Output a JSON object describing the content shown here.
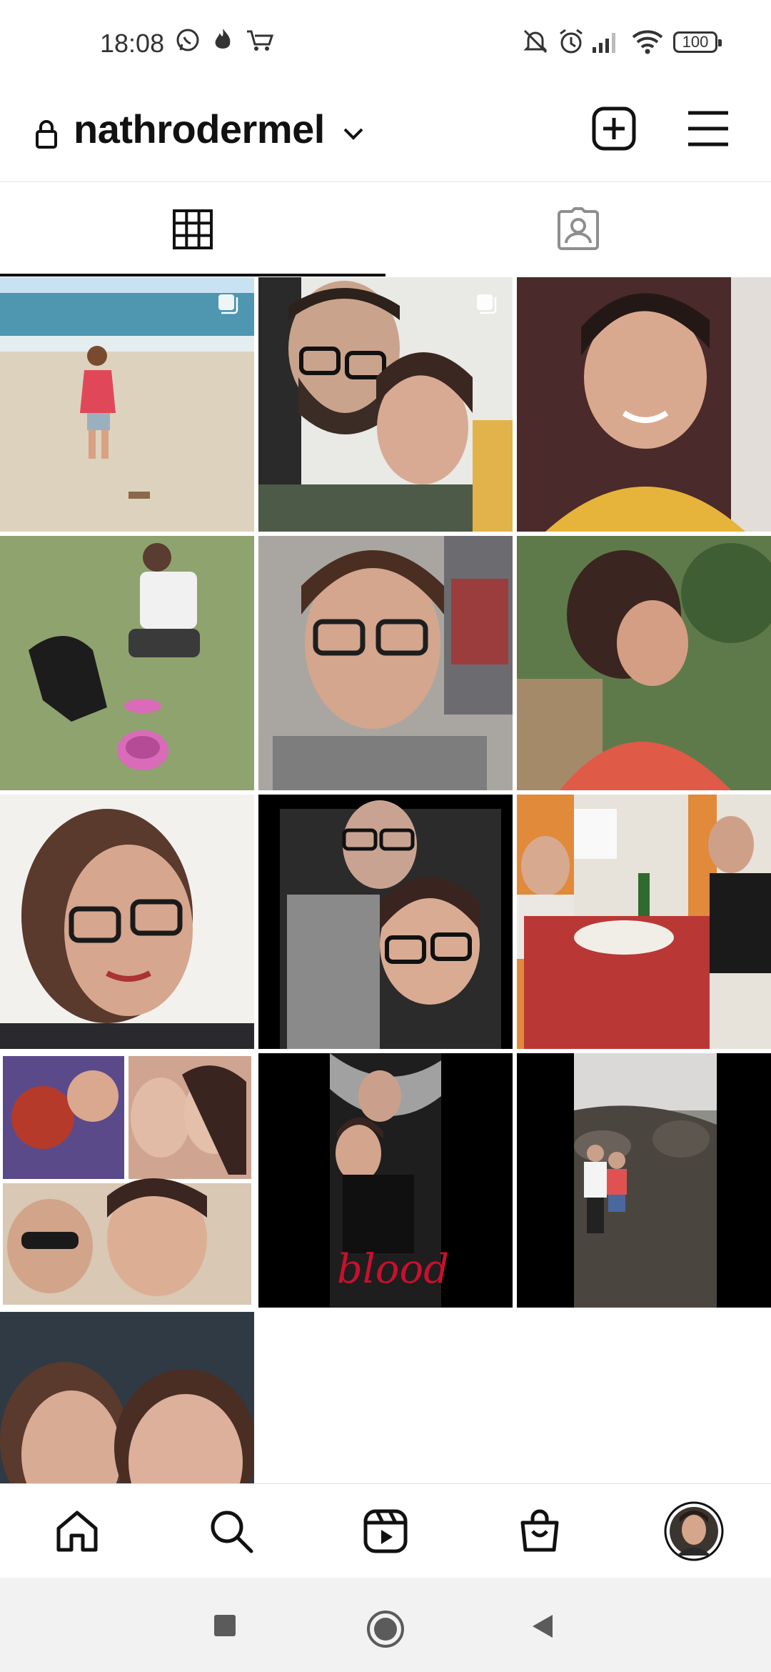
{
  "status_bar": {
    "time": "18:08",
    "battery": "100",
    "left_icons": [
      "whatsapp-icon",
      "flame-icon",
      "shopping-cart-icon"
    ],
    "right_icons": [
      "muted-bell-icon",
      "alarm-icon",
      "signal-icon",
      "wifi-icon",
      "battery-icon"
    ]
  },
  "header": {
    "username": "nathrodermel",
    "icons": [
      "lock-icon",
      "chevron-down-icon",
      "new-post-icon",
      "menu-icon"
    ]
  },
  "tabs": [
    {
      "name": "posts-grid",
      "icon": "grid-icon",
      "active": true
    },
    {
      "name": "tagged",
      "icon": "tagged-person-icon",
      "active": false
    }
  ],
  "posts": [
    {
      "id": 1,
      "description": "beach-photo",
      "multi": true
    },
    {
      "id": 2,
      "description": "couple-selfie",
      "multi": true
    },
    {
      "id": 3,
      "description": "portrait-yellow-top",
      "multi": false
    },
    {
      "id": 4,
      "description": "dog-on-grass",
      "multi": false
    },
    {
      "id": 5,
      "description": "selfie-glasses",
      "multi": false
    },
    {
      "id": 6,
      "description": "profile-garden",
      "multi": false
    },
    {
      "id": 7,
      "description": "selfie-bright",
      "multi": false
    },
    {
      "id": 8,
      "description": "couple-night",
      "multi": false
    },
    {
      "id": 9,
      "description": "dinner-table",
      "multi": false
    },
    {
      "id": 10,
      "description": "collage",
      "multi": false
    },
    {
      "id": 11,
      "description": "blood-shirt-couple",
      "multi": false
    },
    {
      "id": 12,
      "description": "rocks-seaside",
      "multi": false
    },
    {
      "id": 13,
      "description": "two-women-selfie",
      "multi": false
    }
  ],
  "post_overlay_text": {
    "blood": "blood"
  },
  "bottom_nav": [
    "home-icon",
    "search-icon",
    "reels-icon",
    "shop-icon",
    "profile-avatar"
  ],
  "colors": {
    "text": "#111111",
    "divider": "#e6e6e6",
    "sysnav": "#f2f2f2"
  }
}
